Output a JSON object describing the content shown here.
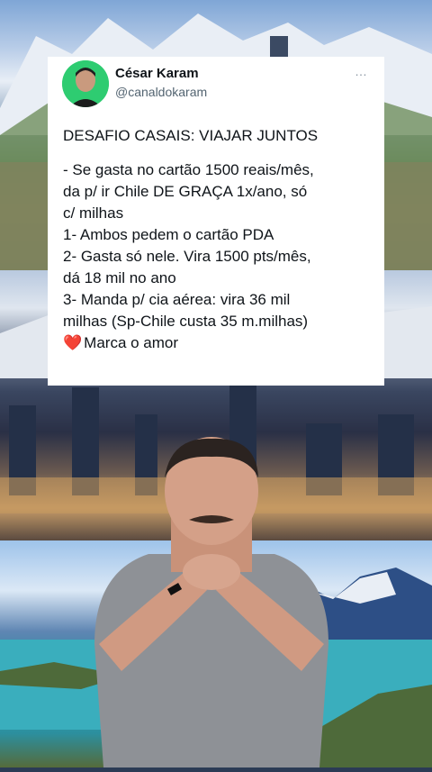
{
  "author": {
    "name": "César Karam",
    "handle": "@canaldokaram",
    "avatar_icon": "avatar-photo",
    "avatar_bg": "#2ecc71"
  },
  "more_icon": "…",
  "tweet": {
    "title": "DESAFIO CASAIS: VIAJAR JUNTOS",
    "lines": [
      "- Se gasta no cartão 1500 reais/mês,",
      "da p/ ir Chile DE GRAÇA 1x/ano, só",
      "c/ milhas",
      "1- Ambos pedem o cartão PDA",
      "2- Gasta só nele. Vira 1500 pts/mês,",
      "dá 18 mil no ano",
      "3- Manda p/ cia aérea: vira 36 mil",
      "milhas (Sp-Chile custa 35 m.milhas)"
    ],
    "last_line_emoji": "❤️",
    "last_line_text": "Marca o amor"
  }
}
